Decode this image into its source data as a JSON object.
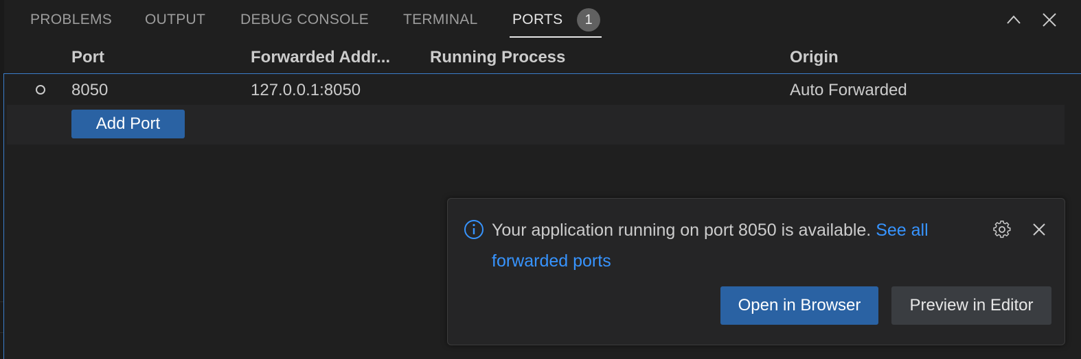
{
  "panel": {
    "tabs": [
      {
        "label": "PROBLEMS",
        "active": false
      },
      {
        "label": "OUTPUT",
        "active": false
      },
      {
        "label": "DEBUG CONSOLE",
        "active": false
      },
      {
        "label": "TERMINAL",
        "active": false
      },
      {
        "label": "PORTS",
        "active": true,
        "badge": "1"
      }
    ],
    "actions": [
      {
        "icon": "chevron-up-icon"
      },
      {
        "icon": "close-icon"
      }
    ]
  },
  "ports_table": {
    "columns": [
      "Port",
      "Forwarded Addr...",
      "Running Process",
      "Origin"
    ],
    "rows": [
      {
        "status_icon": "circle-outline-icon",
        "port": "8050",
        "forwarded_address": "127.0.0.1:8050",
        "running_process": "",
        "origin": "Auto Forwarded"
      }
    ],
    "add_port_label": "Add Port"
  },
  "notification": {
    "icon": "info-icon",
    "message": "Your application running on port 8050 is available.",
    "link_text": "See all forwarded ports",
    "primary_button": "Open in Browser",
    "secondary_button": "Preview in Editor"
  },
  "colors": {
    "background": "#1f1f1f",
    "focus_border": "#3a7ecb",
    "primary_button": "#2a62a3",
    "link": "#3794ff",
    "badge": "#616161"
  }
}
